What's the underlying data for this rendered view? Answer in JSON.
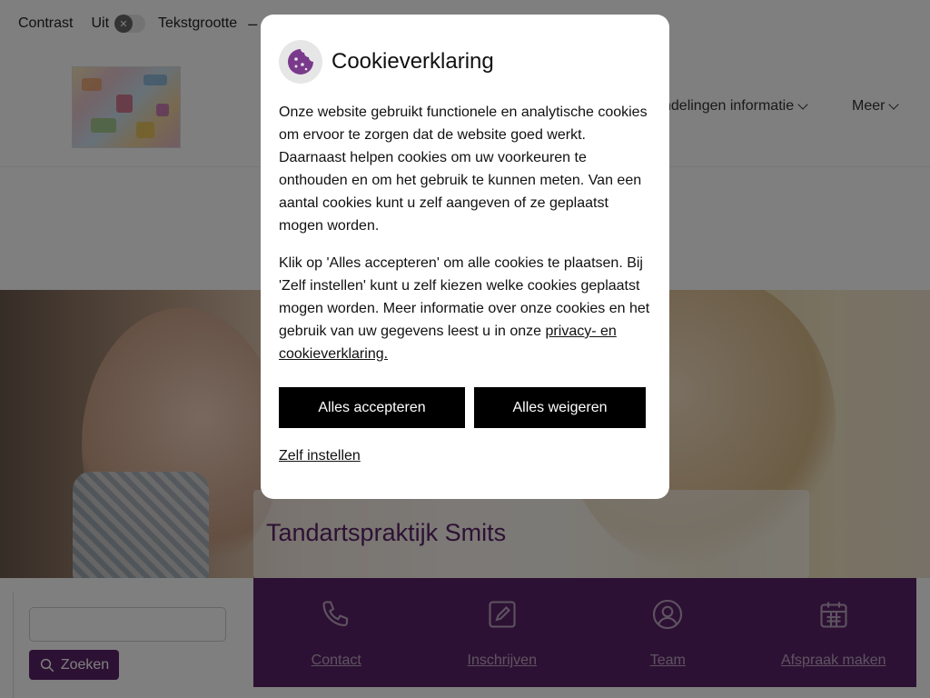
{
  "accessibility_bar": {
    "contrast_label": "Contrast",
    "contrast_value": "Uit",
    "toggle_knob_glyph": "✕",
    "text_size_label": "Tekstgrootte",
    "text_size_minus": "–"
  },
  "nav": {
    "items": [
      {
        "label": "ndelingen informatie"
      },
      {
        "label": "Meer"
      }
    ]
  },
  "hero": {
    "title": "Tandartspraktijk Smits"
  },
  "search": {
    "placeholder": "",
    "button_label": "Zoeken"
  },
  "quicklinks": [
    {
      "label": "Contact",
      "icon": "phone-icon"
    },
    {
      "label": "Inschrijven",
      "icon": "edit-icon"
    },
    {
      "label": "Team",
      "icon": "user-circle-icon"
    },
    {
      "label": "Afspraak maken",
      "icon": "calendar-icon"
    }
  ],
  "cookie_dialog": {
    "title": "Cookieverklaring",
    "paragraph1": "Onze website gebruikt functionele en analytische cookies om ervoor te zorgen dat de website goed werkt. Daarnaast helpen cookies om uw voorkeuren te onthouden en om het gebruik te kunnen meten. Van een aantal cookies kunt u zelf aangeven of ze geplaatst mogen worden.",
    "paragraph2_text": "Klik op 'Alles accepteren' om alle cookies te plaatsen. Bij 'Zelf instellen' kunt u zelf kiezen welke cookies geplaatst mogen worden. Meer informatie over onze cookies en het gebruik van uw gegevens leest u in onze ",
    "paragraph2_link": "privacy- en cookieverklaring.",
    "accept_label": "Alles accepteren",
    "reject_label": "Alles weigeren",
    "custom_label": "Zelf instellen"
  },
  "colors": {
    "brand_purple": "#5b2368",
    "dialog_button": "#000000",
    "overlay": "rgba(0,0,0,0.5)"
  }
}
